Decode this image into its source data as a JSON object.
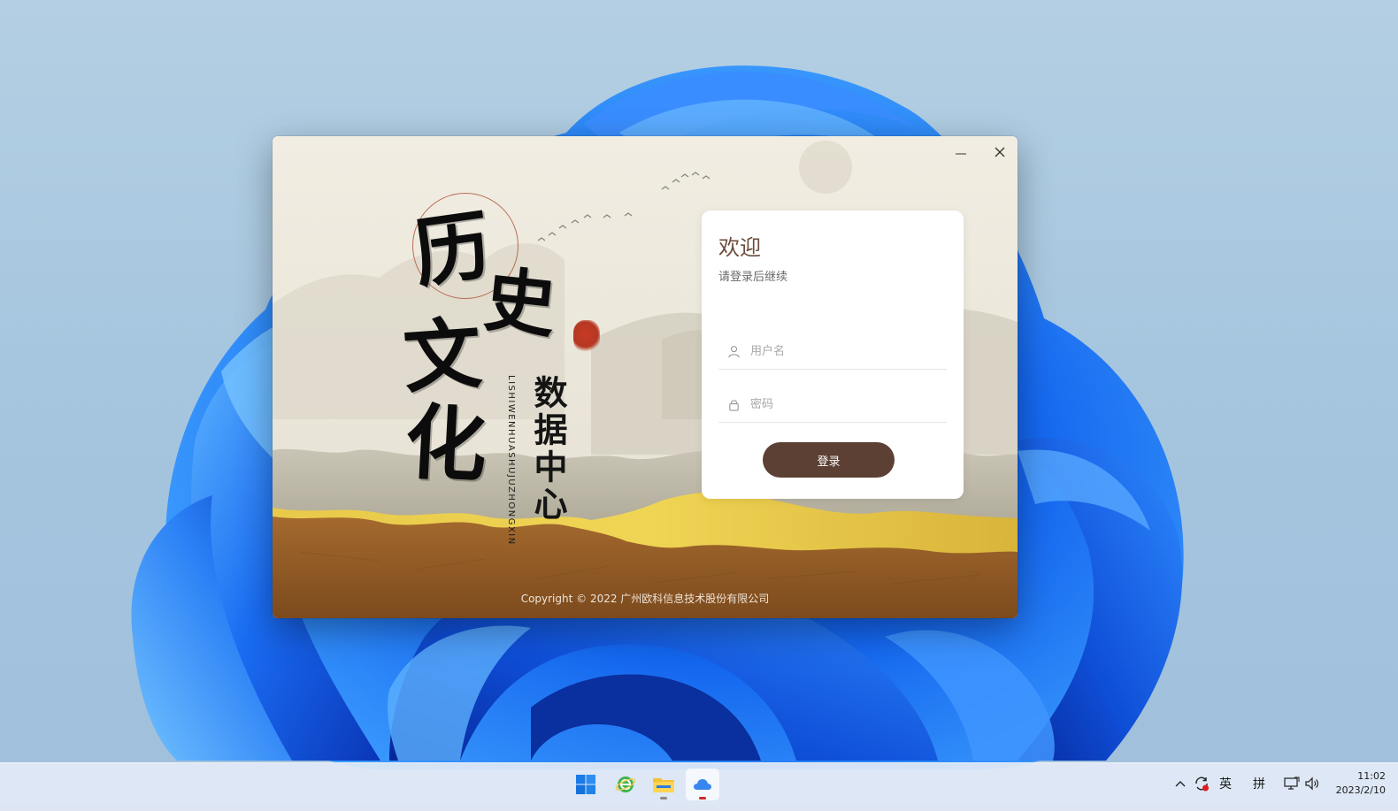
{
  "window": {
    "calligraphy": [
      "历",
      "史",
      "文",
      "化"
    ],
    "subtitle": "数据中心",
    "pinyin": "LISHIWENHUASHUJUZHONGXIN",
    "copyright": "Copyright © 2022 广州欧科信息技术股份有限公司",
    "controls": {
      "minimize": "minimize-icon",
      "close": "close-icon"
    }
  },
  "login": {
    "title": "欢迎",
    "subtitle": "请登录后继续",
    "username_placeholder": "用户名",
    "password_placeholder": "密码",
    "submit_label": "登录",
    "button_color": "#5b4033",
    "title_color": "#6e4d3c"
  },
  "taskbar": {
    "apps": [
      {
        "name": "start",
        "icon": "windows-start-icon"
      },
      {
        "name": "browser",
        "icon": "browser-e-icon"
      },
      {
        "name": "file-explorer",
        "icon": "folder-icon"
      },
      {
        "name": "cloud-app",
        "icon": "cloud-icon",
        "active": true
      }
    ],
    "tray": {
      "chevron": "chevron-up-icon",
      "sync": "sync-alert-icon",
      "ime_lang": "英",
      "ime_mode": "拼",
      "network": "network-icon",
      "volume": "volume-icon"
    },
    "time": "11:02",
    "date": "2023/2/10"
  }
}
